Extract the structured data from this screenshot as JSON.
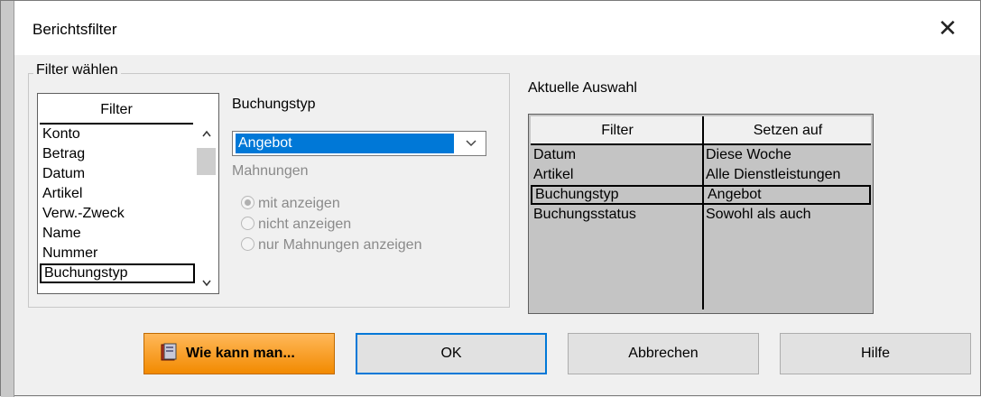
{
  "window": {
    "title": "Berichtsfilter",
    "close_symbol": "✕"
  },
  "filter_group": {
    "legend": "Filter wählen",
    "list_header": "Filter",
    "items": [
      "Konto",
      "Betrag",
      "Datum",
      "Artikel",
      "Verw.-Zweck",
      "Name",
      "Nummer",
      "Buchungstyp"
    ],
    "selected_item": "Buchungstyp"
  },
  "buchungstyp": {
    "label": "Buchungstyp",
    "selected_value": "Angebot"
  },
  "mahnungen": {
    "label": "Mahnungen",
    "options": [
      "mit anzeigen",
      "nicht anzeigen",
      "nur Mahnungen anzeigen"
    ],
    "selected": "mit anzeigen",
    "enabled": false
  },
  "current_selection": {
    "label": "Aktuelle Auswahl",
    "columns": [
      "Filter",
      "Setzen auf"
    ],
    "rows": [
      [
        "Datum",
        "Diese Woche"
      ],
      [
        "Artikel",
        "Alle Dienstleistungen"
      ],
      [
        "Buchungstyp",
        "Angebot"
      ],
      [
        "Buchungsstatus",
        "Sowohl als auch"
      ]
    ],
    "selected_row": "Buchungstyp"
  },
  "buttons": {
    "help_howto": "Wie kann man...",
    "ok": "OK",
    "cancel": "Abbrechen",
    "help": "Hilfe"
  },
  "colors": {
    "accent": "#0078d7",
    "help_button": "#f28a00",
    "grid_bg": "#c4c4c4"
  }
}
